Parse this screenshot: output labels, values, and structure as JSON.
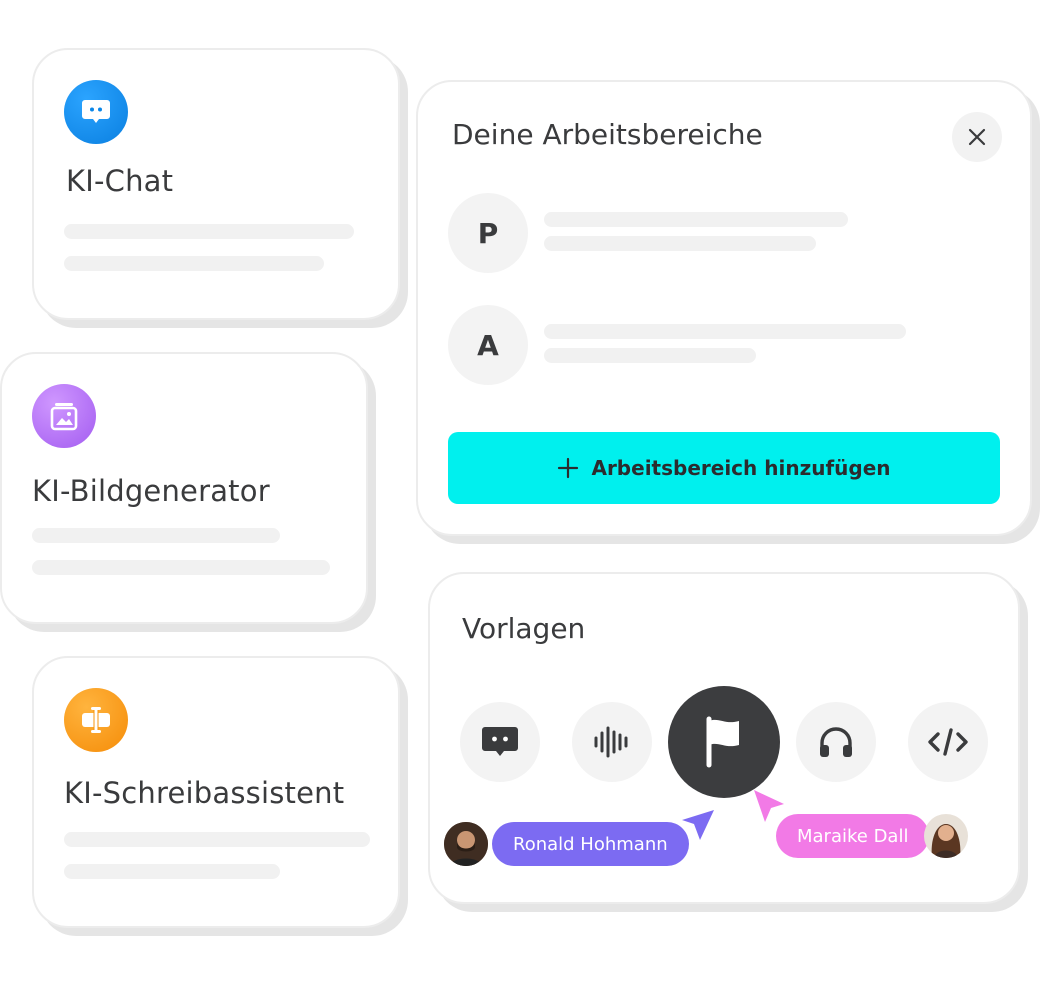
{
  "apps": {
    "chat": {
      "title": "KI-Chat",
      "icon": "chat-bubble-icon",
      "color": "#0a86e8"
    },
    "image": {
      "title": "KI-Bildgenerator",
      "icon": "image-gallery-icon",
      "color": "#b06cf2"
    },
    "writer": {
      "title": "KI-Schreibassistent",
      "icon": "text-cursor-icon",
      "color": "#f7950f"
    }
  },
  "workspaces": {
    "title": "Deine Arbeitsbereiche",
    "close_icon": "close-icon",
    "items": [
      {
        "initial": "P"
      },
      {
        "initial": "A"
      }
    ],
    "add_label": "Arbeitsbereich hinzufügen",
    "add_icon": "plus-icon",
    "accent": "#00f0ee"
  },
  "templates": {
    "title": "Vorlagen",
    "buttons": [
      {
        "icon": "chat-bubble-icon"
      },
      {
        "icon": "audio-waveform-icon"
      },
      {
        "icon": "flag-icon",
        "active": true
      },
      {
        "icon": "headphones-icon"
      },
      {
        "icon": "code-icon"
      }
    ]
  },
  "collaborators": [
    {
      "name": "Ronald Hohmann",
      "color": "#7c6bf2"
    },
    {
      "name": "Maraike Dall",
      "color": "#f27ae6"
    }
  ]
}
